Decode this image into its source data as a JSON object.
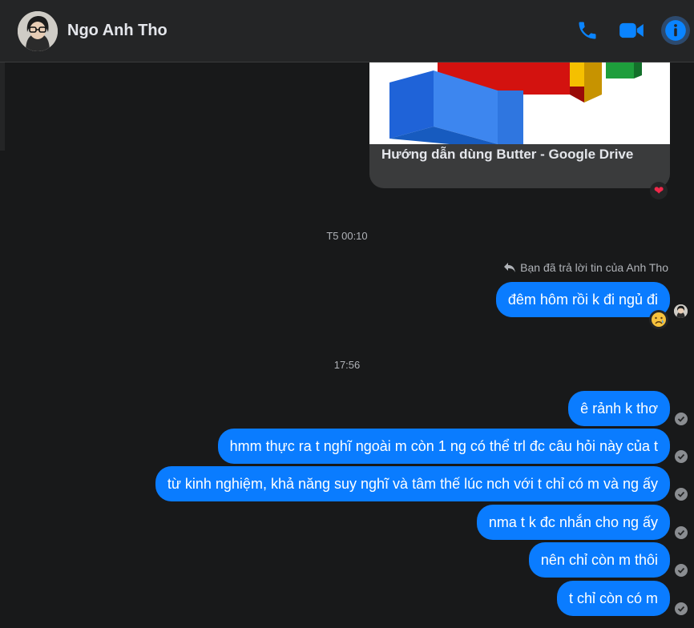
{
  "header": {
    "contact_name": "Ngo Anh Tho",
    "icons": [
      "phone-icon",
      "video-icon",
      "info-icon"
    ],
    "accent_color": "#0a84ff"
  },
  "link_preview": {
    "title": "Hướng dẫn dùng Butter - Google Drive",
    "reaction": "❤"
  },
  "timestamps": [
    "T5 00:10",
    "17:56"
  ],
  "reply": {
    "note": "Bạn đã trả lời tin của Anh Tho",
    "message": "đêm hôm rồi k đi ngủ đi",
    "reaction": "😢"
  },
  "messages": [
    "ê rảnh k thơ",
    "hmm thực ra t nghĩ ngoài m còn 1 ng có thể trl đc câu hỏi này của t",
    "từ kinh nghiệm, khả năng suy nghĩ và tâm thế lúc nch với t chỉ có m và ng ấy",
    "nma t k đc nhắn cho ng ấy",
    "nên chỉ còn m thôi",
    "t chỉ còn có m"
  ],
  "colors": {
    "bubble": "#0a7cff",
    "background": "#18191a",
    "header": "#242526"
  }
}
